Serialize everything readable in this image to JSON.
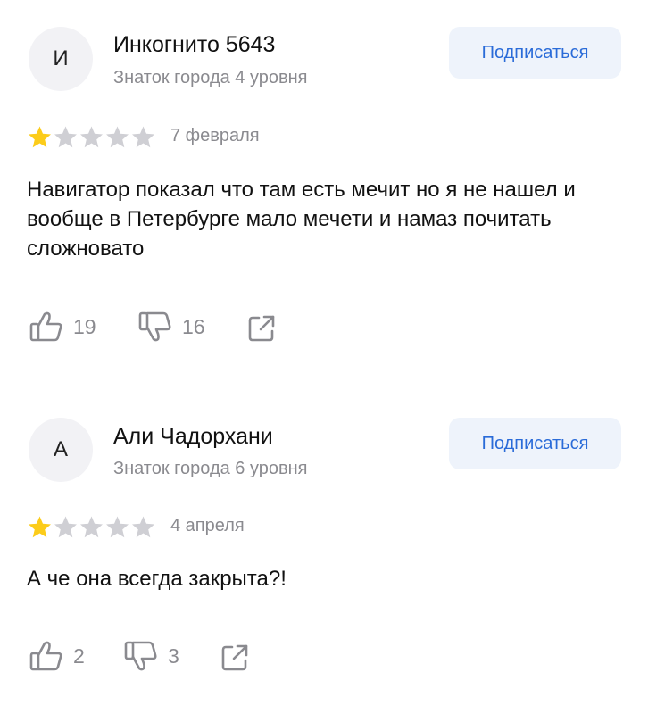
{
  "reviews": [
    {
      "avatar_letter": "И",
      "author": "Инкогнито 5643",
      "level": "Знаток города 4 уровня",
      "subscribe_label": "Подписаться",
      "rating": 1,
      "rating_max": 5,
      "date": "7 февраля",
      "text": "Навигатор показал что там есть мечит но я не нашел и вообще в Петербурге мало мечети и намаз почитать сложновато",
      "likes": "19",
      "dislikes": "16"
    },
    {
      "avatar_letter": "А",
      "author": "Али Чадорхани",
      "level": "Знаток города 6 уровня",
      "subscribe_label": "Подписаться",
      "rating": 1,
      "rating_max": 5,
      "date": "4 апреля",
      "text": "А че она всегда закрыта?!",
      "likes": "2",
      "dislikes": "3"
    }
  ],
  "icons": {
    "like": "thumbs-up-icon",
    "dislike": "thumbs-down-icon",
    "share": "share-icon",
    "star": "star-icon"
  },
  "colors": {
    "star_filled": "#fccc1a",
    "star_empty": "#cfcfd4",
    "accent": "#2a6bd8",
    "button_bg": "#eef3fb",
    "secondary_text": "#8a8a8f"
  }
}
